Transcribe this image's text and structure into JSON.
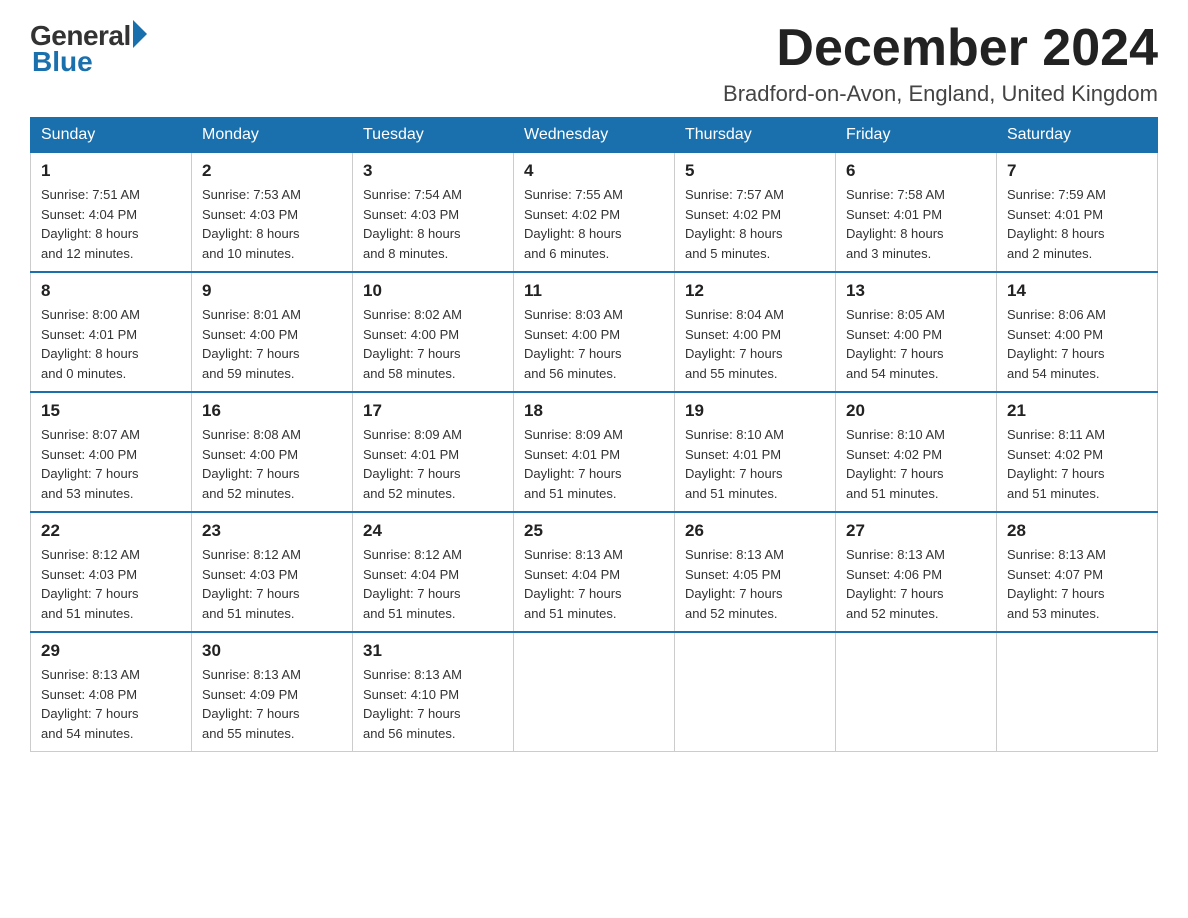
{
  "header": {
    "logo_general": "General",
    "logo_blue": "Blue",
    "month_title": "December 2024",
    "location": "Bradford-on-Avon, England, United Kingdom"
  },
  "weekdays": [
    "Sunday",
    "Monday",
    "Tuesday",
    "Wednesday",
    "Thursday",
    "Friday",
    "Saturday"
  ],
  "weeks": [
    [
      {
        "day": "1",
        "sunrise": "7:51 AM",
        "sunset": "4:04 PM",
        "daylight": "8 hours and 12 minutes."
      },
      {
        "day": "2",
        "sunrise": "7:53 AM",
        "sunset": "4:03 PM",
        "daylight": "8 hours and 10 minutes."
      },
      {
        "day": "3",
        "sunrise": "7:54 AM",
        "sunset": "4:03 PM",
        "daylight": "8 hours and 8 minutes."
      },
      {
        "day": "4",
        "sunrise": "7:55 AM",
        "sunset": "4:02 PM",
        "daylight": "8 hours and 6 minutes."
      },
      {
        "day": "5",
        "sunrise": "7:57 AM",
        "sunset": "4:02 PM",
        "daylight": "8 hours and 5 minutes."
      },
      {
        "day": "6",
        "sunrise": "7:58 AM",
        "sunset": "4:01 PM",
        "daylight": "8 hours and 3 minutes."
      },
      {
        "day": "7",
        "sunrise": "7:59 AM",
        "sunset": "4:01 PM",
        "daylight": "8 hours and 2 minutes."
      }
    ],
    [
      {
        "day": "8",
        "sunrise": "8:00 AM",
        "sunset": "4:01 PM",
        "daylight": "8 hours and 0 minutes."
      },
      {
        "day": "9",
        "sunrise": "8:01 AM",
        "sunset": "4:00 PM",
        "daylight": "7 hours and 59 minutes."
      },
      {
        "day": "10",
        "sunrise": "8:02 AM",
        "sunset": "4:00 PM",
        "daylight": "7 hours and 58 minutes."
      },
      {
        "day": "11",
        "sunrise": "8:03 AM",
        "sunset": "4:00 PM",
        "daylight": "7 hours and 56 minutes."
      },
      {
        "day": "12",
        "sunrise": "8:04 AM",
        "sunset": "4:00 PM",
        "daylight": "7 hours and 55 minutes."
      },
      {
        "day": "13",
        "sunrise": "8:05 AM",
        "sunset": "4:00 PM",
        "daylight": "7 hours and 54 minutes."
      },
      {
        "day": "14",
        "sunrise": "8:06 AM",
        "sunset": "4:00 PM",
        "daylight": "7 hours and 54 minutes."
      }
    ],
    [
      {
        "day": "15",
        "sunrise": "8:07 AM",
        "sunset": "4:00 PM",
        "daylight": "7 hours and 53 minutes."
      },
      {
        "day": "16",
        "sunrise": "8:08 AM",
        "sunset": "4:00 PM",
        "daylight": "7 hours and 52 minutes."
      },
      {
        "day": "17",
        "sunrise": "8:09 AM",
        "sunset": "4:01 PM",
        "daylight": "7 hours and 52 minutes."
      },
      {
        "day": "18",
        "sunrise": "8:09 AM",
        "sunset": "4:01 PM",
        "daylight": "7 hours and 51 minutes."
      },
      {
        "day": "19",
        "sunrise": "8:10 AM",
        "sunset": "4:01 PM",
        "daylight": "7 hours and 51 minutes."
      },
      {
        "day": "20",
        "sunrise": "8:10 AM",
        "sunset": "4:02 PM",
        "daylight": "7 hours and 51 minutes."
      },
      {
        "day": "21",
        "sunrise": "8:11 AM",
        "sunset": "4:02 PM",
        "daylight": "7 hours and 51 minutes."
      }
    ],
    [
      {
        "day": "22",
        "sunrise": "8:12 AM",
        "sunset": "4:03 PM",
        "daylight": "7 hours and 51 minutes."
      },
      {
        "day": "23",
        "sunrise": "8:12 AM",
        "sunset": "4:03 PM",
        "daylight": "7 hours and 51 minutes."
      },
      {
        "day": "24",
        "sunrise": "8:12 AM",
        "sunset": "4:04 PM",
        "daylight": "7 hours and 51 minutes."
      },
      {
        "day": "25",
        "sunrise": "8:13 AM",
        "sunset": "4:04 PM",
        "daylight": "7 hours and 51 minutes."
      },
      {
        "day": "26",
        "sunrise": "8:13 AM",
        "sunset": "4:05 PM",
        "daylight": "7 hours and 52 minutes."
      },
      {
        "day": "27",
        "sunrise": "8:13 AM",
        "sunset": "4:06 PM",
        "daylight": "7 hours and 52 minutes."
      },
      {
        "day": "28",
        "sunrise": "8:13 AM",
        "sunset": "4:07 PM",
        "daylight": "7 hours and 53 minutes."
      }
    ],
    [
      {
        "day": "29",
        "sunrise": "8:13 AM",
        "sunset": "4:08 PM",
        "daylight": "7 hours and 54 minutes."
      },
      {
        "day": "30",
        "sunrise": "8:13 AM",
        "sunset": "4:09 PM",
        "daylight": "7 hours and 55 minutes."
      },
      {
        "day": "31",
        "sunrise": "8:13 AM",
        "sunset": "4:10 PM",
        "daylight": "7 hours and 56 minutes."
      },
      null,
      null,
      null,
      null
    ]
  ],
  "labels": {
    "sunrise": "Sunrise:",
    "sunset": "Sunset:",
    "daylight": "Daylight:"
  }
}
